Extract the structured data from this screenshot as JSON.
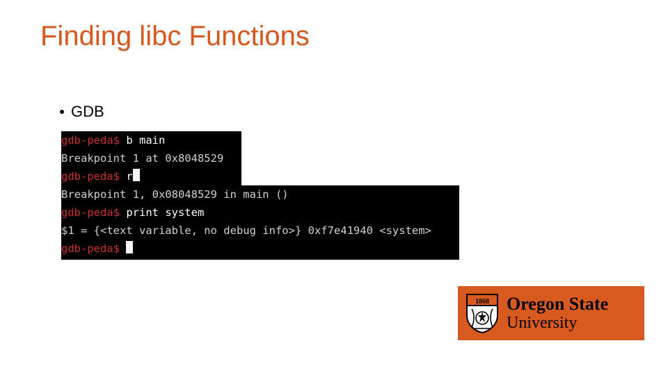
{
  "title": "Finding libc Functions",
  "bullet": "GDB",
  "terminal": {
    "prompt": "gdb-peda$",
    "lines": {
      "cmd1": "b main",
      "out1": "Breakpoint 1 at 0x8048529",
      "cmd2": "r",
      "out2": "Breakpoint 1, 0x08048529 in main ()",
      "cmd3": "print system",
      "out3": "$1 = {<text variable, no debug info>} 0xf7e41940 <system>"
    }
  },
  "logo": {
    "line1": "Oregon State",
    "line2": "University"
  }
}
